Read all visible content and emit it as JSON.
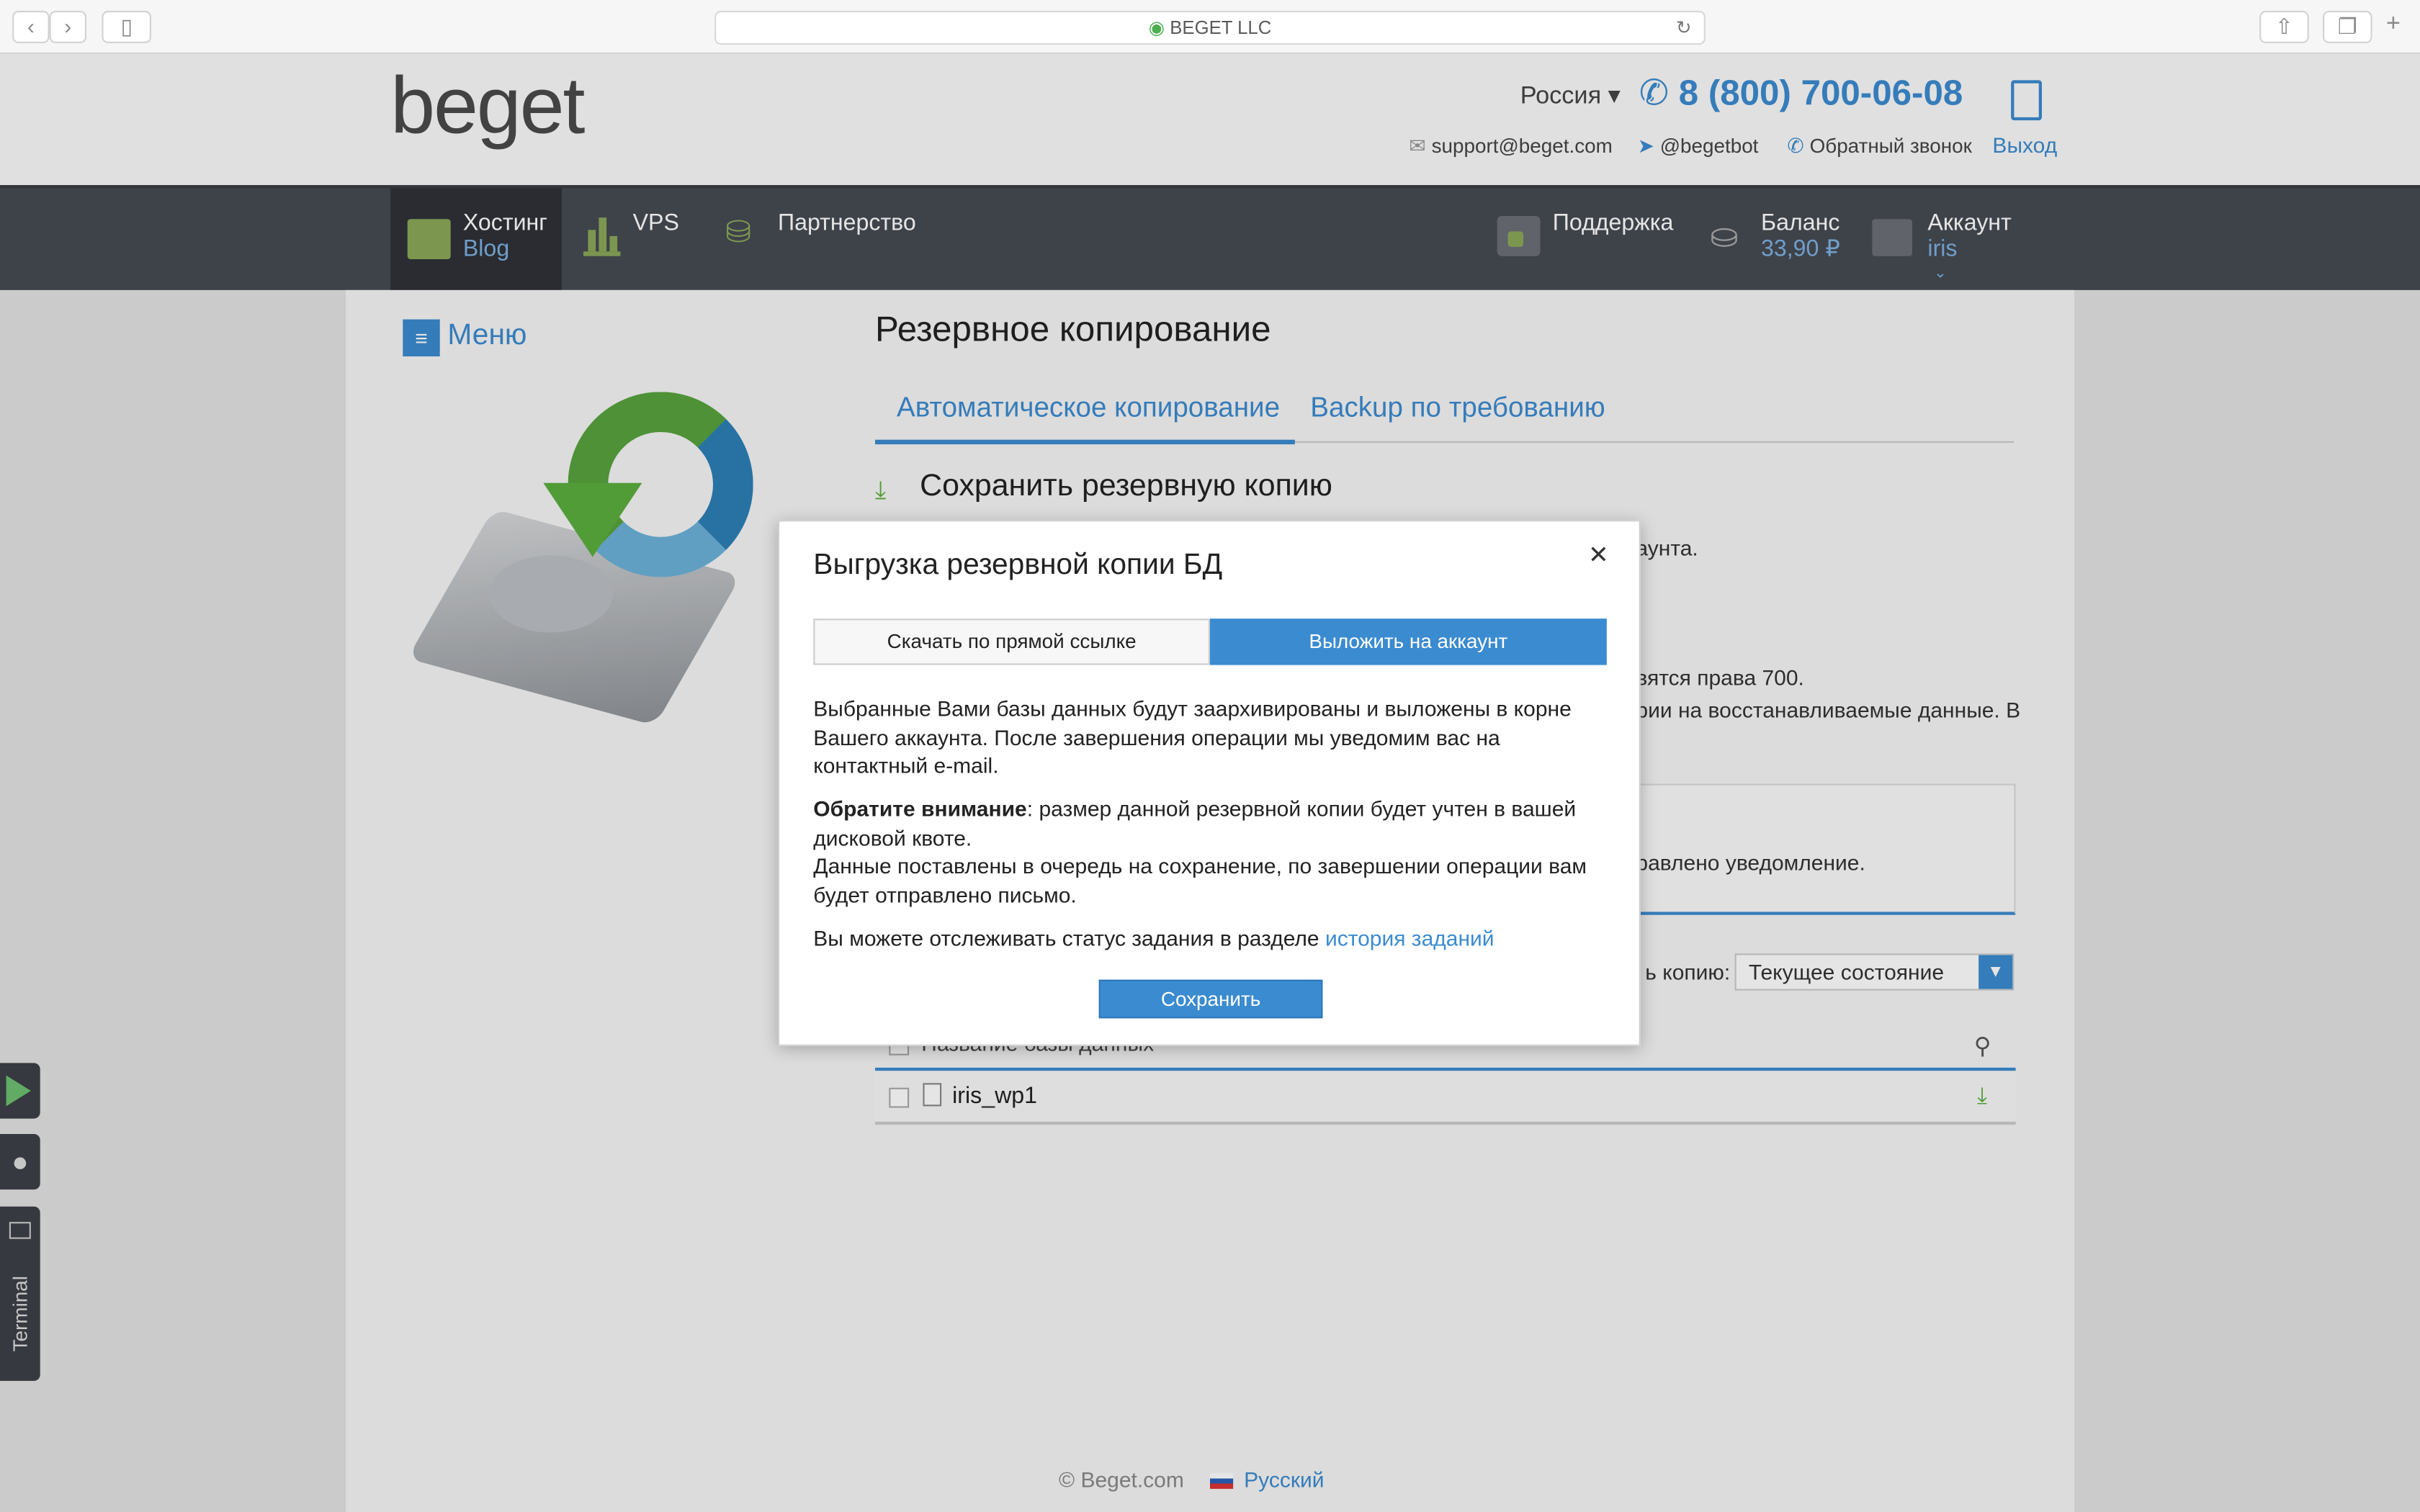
{
  "browser": {
    "url_title": "BEGET LLC"
  },
  "header": {
    "logo": "beget",
    "region": "Россия",
    "phone": "8 (800) 700-06-08",
    "email": "support@beget.com",
    "telegram": "@begetbot",
    "callback": "Обратный звонок",
    "logout": "Выход"
  },
  "nav": {
    "hosting": {
      "label": "Хостинг",
      "sub": "Blog"
    },
    "vps": "VPS",
    "partners": "Партнерство",
    "support": "Поддержка",
    "balance": {
      "label": "Баланс",
      "value": "33,90 ₽"
    },
    "account": {
      "label": "Аккаунт",
      "user": "iris"
    }
  },
  "sidebar": {
    "menu": "Меню"
  },
  "page": {
    "title": "Резервное копирование",
    "tabs": [
      "Автоматическое копирование",
      "Backup по требованию"
    ],
    "section_title": "Сохранить резервную копию",
    "bg_text_1": "аунта.",
    "bg_text_2": "вятся права 700.",
    "bg_text_3": "рии на восстанавливаемые данные. В",
    "bg_text_4": "равлено уведомление.",
    "copy_label": "ь копию:",
    "copy_select": "Текущее состояние",
    "table_header": "Название базы данных",
    "db_row": "iris_wp1"
  },
  "footer": {
    "copyright": "© Beget.com",
    "language": "Русский"
  },
  "side_apps": {
    "terminal": "Terminal"
  },
  "modal": {
    "title": "Выгрузка резервной копии БД",
    "tab_direct": "Скачать по прямой ссылке",
    "tab_account": "Выложить на аккаунт",
    "p1": "Выбранные Вами базы данных будут заархивированы и выложены в корне Вашего аккаунта. После завершения операции мы уведомим вас на контактный e-mail.",
    "p2_bold": "Обратите внимание",
    "p2_rest": ": размер данной резервной копии будет учтен в вашей дисковой квоте.",
    "p3": "Данные поставлены в очередь на сохранение, по завершении операции вам будет отправлено письмо.",
    "p4": "Вы можете отслеживать статус задания в разделе ",
    "p4_link": "история заданий",
    "save": "Сохранить"
  },
  "colors": {
    "accent": "#3b8bd0",
    "navbar": "#464a52",
    "green": "#5cae3e"
  }
}
